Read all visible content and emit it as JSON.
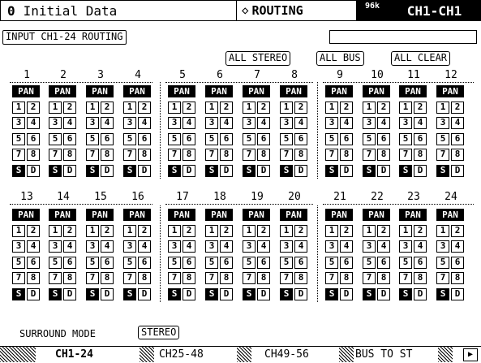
{
  "header": {
    "scene_number": "0",
    "scene_name": "Initial Data",
    "page_title": "ROUTING",
    "sample_rate": "96k",
    "channel": "CH1-CH1"
  },
  "subheader": {
    "title": "INPUT CH1-24 ROUTING",
    "name_field": ""
  },
  "buttons": {
    "all_stereo": "ALL STEREO",
    "all_bus": "ALL BUS",
    "all_clear": "ALL CLEAR"
  },
  "channels_row1": [
    "1",
    "2",
    "3",
    "4",
    "5",
    "6",
    "7",
    "8",
    "9",
    "10",
    "11",
    "12"
  ],
  "channels_row2": [
    "13",
    "14",
    "15",
    "16",
    "17",
    "18",
    "19",
    "20",
    "21",
    "22",
    "23",
    "24"
  ],
  "routing_cells": {
    "pan": "PAN",
    "pairs": [
      [
        "1",
        "2"
      ],
      [
        "3",
        "4"
      ],
      [
        "5",
        "6"
      ],
      [
        "7",
        "8"
      ],
      [
        "S",
        "D"
      ]
    ]
  },
  "surround": {
    "label": "SURROUND MODE",
    "value": "STEREO"
  },
  "tabs": [
    {
      "label": "CH1-24",
      "active": true
    },
    {
      "label": "CH25-48",
      "active": false
    },
    {
      "label": "CH49-56",
      "active": false
    },
    {
      "label": "BUS TO ST",
      "active": false
    }
  ],
  "tab_arrow": "▶"
}
